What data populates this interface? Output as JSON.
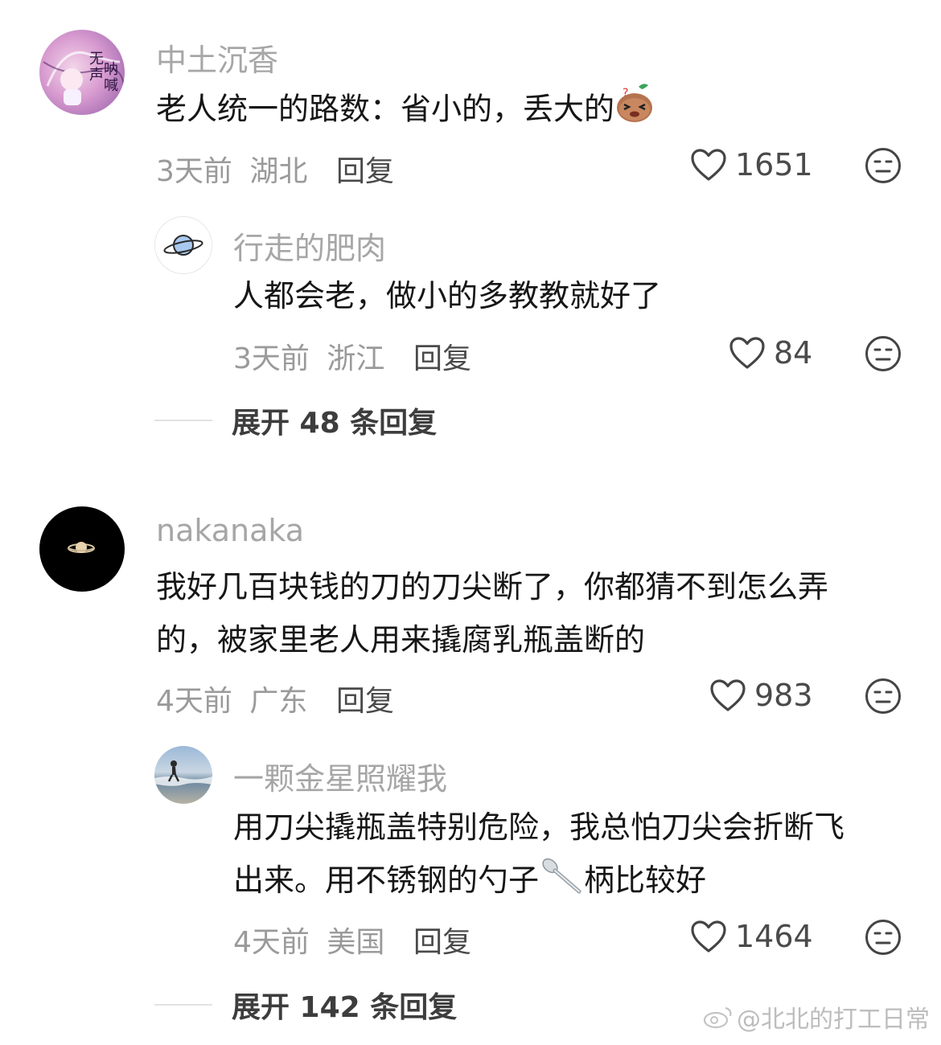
{
  "comments": [
    {
      "username": "中土沉香",
      "text_lines": [
        "老人统一的路数：省小的，丢大的"
      ],
      "emoji": "doge-emoji",
      "time": "3天前",
      "location": "湖北",
      "reply_label": "回复",
      "likes": "1651"
    },
    {
      "username": "行走的肥肉",
      "text_lines": [
        "人都会老，做小的多教教就好了"
      ],
      "time": "3天前",
      "location": "浙江",
      "reply_label": "回复",
      "likes": "84"
    },
    {
      "username": "nakanaka",
      "text_lines": [
        "我好几百块钱的刀的刀尖断了，你都猜不到怎么弄",
        "的，被家里老人用来撬腐乳瓶盖断的"
      ],
      "time": "4天前",
      "location": "广东",
      "reply_label": "回复",
      "likes": "983"
    },
    {
      "username": "一颗金星照耀我",
      "text_lines": [
        "用刀尖撬瓶盖特别危险，我总怕刀尖会折断飞",
        "出来。用不锈钢的勺子",
        "柄比较好"
      ],
      "emoji": "spoon-emoji",
      "time": "4天前",
      "location": "美国",
      "reply_label": "回复",
      "likes": "1464"
    }
  ],
  "expand": [
    {
      "label": "展开 48 条回复"
    },
    {
      "label": "展开 142 条回复"
    }
  ],
  "watermark": "@北北的打工日常",
  "icons": {
    "like": "heart-outline-icon",
    "dislike": "neutral-face-icon"
  },
  "colors": {
    "username": "#a6a6a6",
    "text": "#161616",
    "meta": "#9a9a9a"
  }
}
